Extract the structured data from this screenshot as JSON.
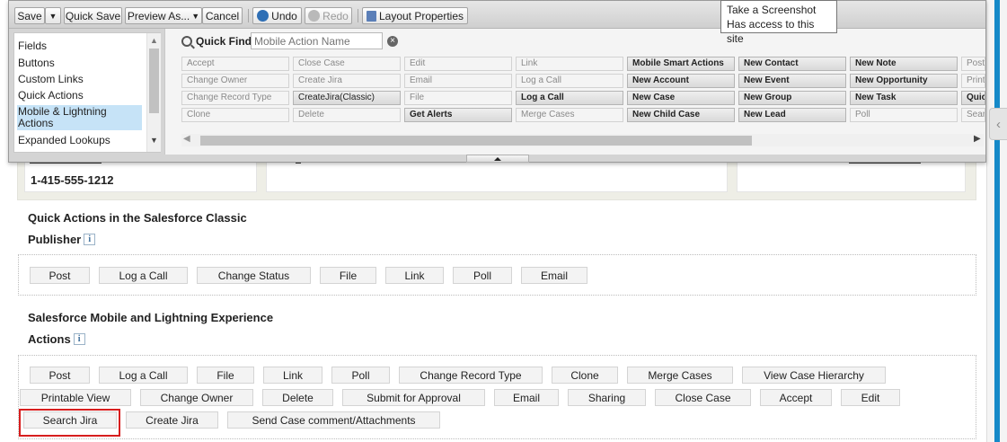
{
  "toolbar": {
    "save": "Save",
    "quick_save": "Quick Save",
    "preview_as": "Preview As...",
    "cancel": "Cancel",
    "undo": "Undo",
    "redo": "Redo",
    "layout_properties": "Layout Properties"
  },
  "tooltip": {
    "line1": "Take a Screenshot",
    "line2": "Has access to this site"
  },
  "categories": {
    "items": [
      "Fields",
      "Buttons",
      "Custom Links",
      "Quick Actions",
      "Mobile & Lightning Actions",
      "Expanded Lookups"
    ],
    "selected": "Mobile & Lightning Actions"
  },
  "quick_find": {
    "label": "Quick Find",
    "placeholder": "Mobile Action Name"
  },
  "palette_actions": {
    "row1": [
      "Accept",
      "Close Case",
      "Edit",
      "Link",
      "Mobile Smart Actions",
      "New Contact",
      "New Note",
      "Post"
    ],
    "row2": [
      "Change Owner",
      "Create Jira",
      "Email",
      "Log a Call",
      "New Account",
      "New Event",
      "New Opportunity",
      "Print"
    ],
    "row3": [
      "Change Record Type",
      "CreateJira(Classic)",
      "File",
      "Log a Call",
      "New Case",
      "New Group",
      "New Task",
      "Quick"
    ],
    "row4": [
      "Clone",
      "Delete",
      "Get Alerts",
      "Merge Cases",
      "New Child Case",
      "New Lead",
      "Poll",
      "Search"
    ]
  },
  "page": {
    "phone": "1-415-555-1212",
    "classic_title_line1": "Quick Actions in the Salesforce Classic",
    "classic_title_line2": "Publisher",
    "mobile_title_line1": "Salesforce Mobile and Lightning Experience",
    "mobile_title_line2": "Actions",
    "info_glyph": "i",
    "classic_actions": [
      "Post",
      "Log a Call",
      "Change Status",
      "File",
      "Link",
      "Poll",
      "Email"
    ],
    "mobile_row1": [
      "Post",
      "Log a Call",
      "File",
      "Link",
      "Poll",
      "Change Record Type",
      "Clone",
      "Merge Cases",
      "View Case Hierarchy"
    ],
    "mobile_row2": [
      "Printable View",
      "Change Owner",
      "Delete",
      "Submit for Approval",
      "Email",
      "Sharing",
      "Close Case",
      "Accept",
      "Edit"
    ],
    "mobile_row3": [
      "Search Jira",
      "Create Jira",
      "Send Case comment/Attachments"
    ]
  },
  "colors": {
    "accent_bar": "#1589c8",
    "highlight_box": "#d71e1e",
    "selected_category": "#c6e3f7"
  }
}
